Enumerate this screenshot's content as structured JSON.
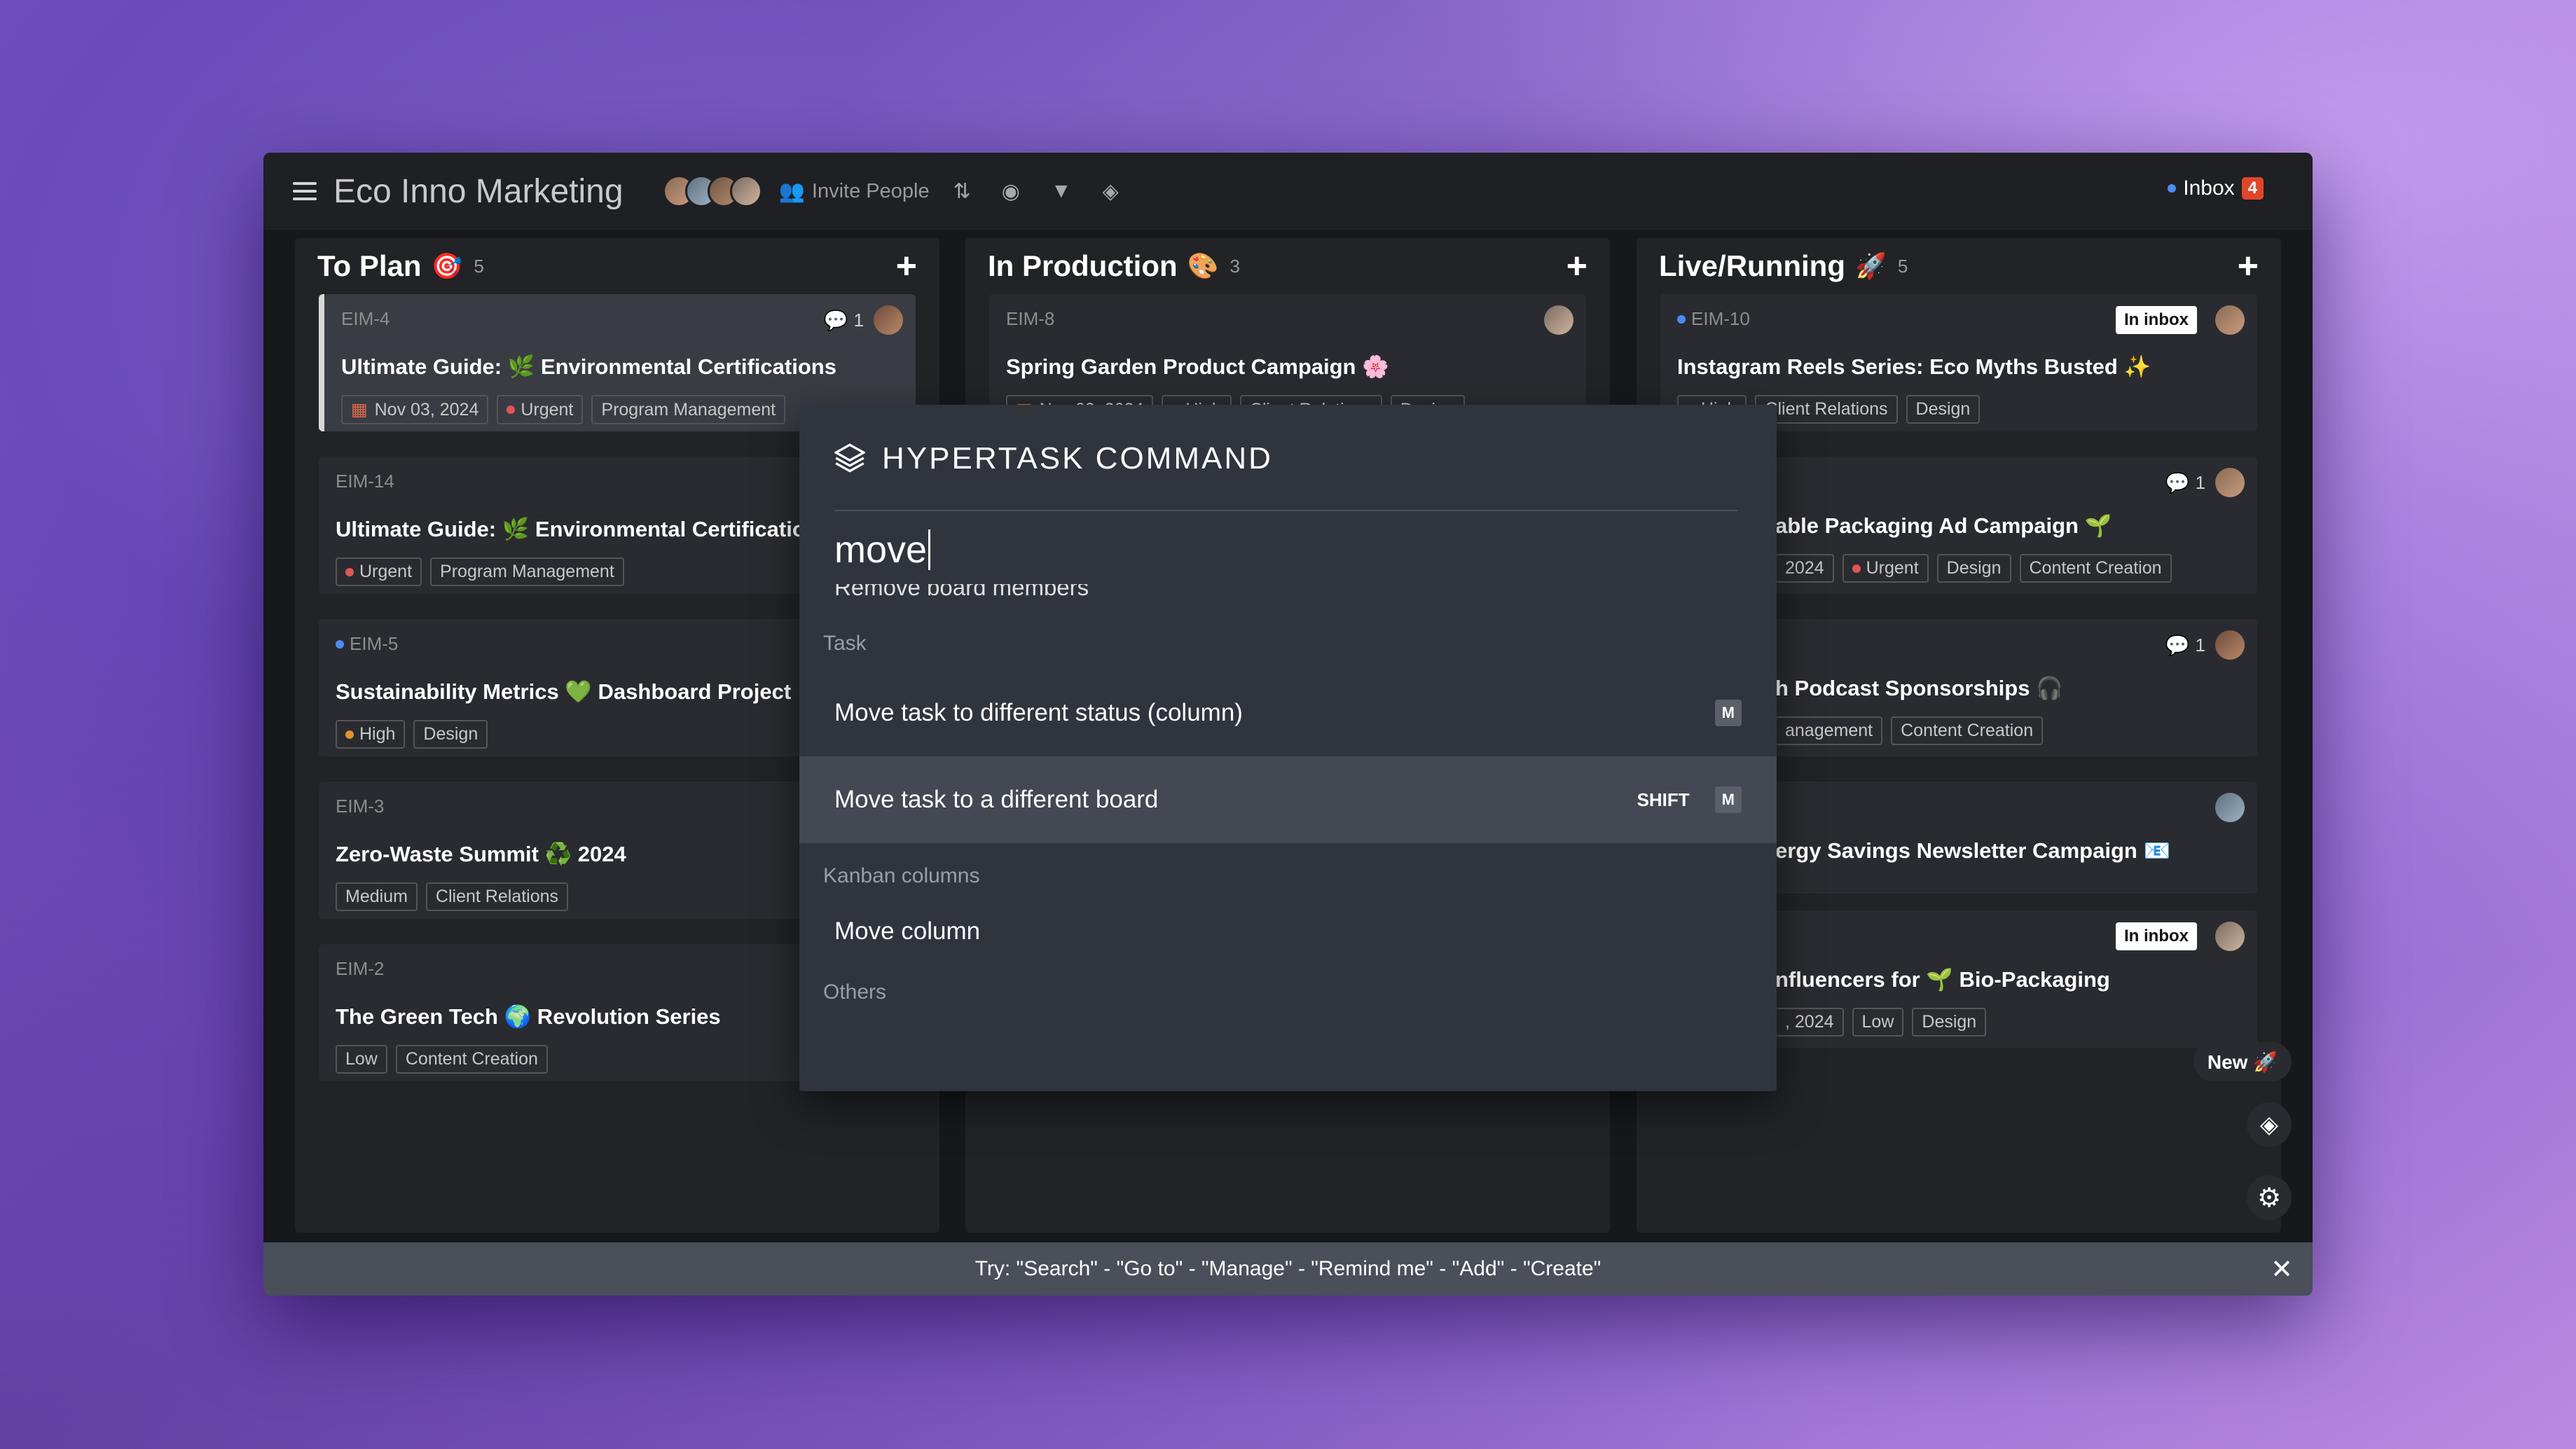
{
  "board": {
    "title": "Eco Inno Marketing",
    "invite_label": "Invite People",
    "inbox_label": "Inbox",
    "inbox_count": "4"
  },
  "columns": [
    {
      "title": "To Plan",
      "emoji": "🎯",
      "count": "5",
      "cards": [
        {
          "id": "EIM-4",
          "title": "Ultimate Guide: 🌿 Environmental Certifications",
          "date": "Nov 03, 2024",
          "priority": "Urgent",
          "tag": "Program Management",
          "comments": "1"
        },
        {
          "id": "EIM-14",
          "title": "Ultimate Guide: 🌿 Environmental Certifications",
          "priority": "Urgent",
          "tag": "Program Management"
        },
        {
          "id": "EIM-5",
          "title": "Sustainability Metrics 💚 Dashboard Project",
          "priority": "High",
          "tag": "Design"
        },
        {
          "id": "EIM-3",
          "title": "Zero-Waste Summit ♻️ 2024",
          "priority": "Medium",
          "tag": "Client Relations"
        },
        {
          "id": "EIM-2",
          "title": "The Green Tech 🌍 Revolution Series",
          "priority": "Low",
          "tag": "Content Creation"
        }
      ]
    },
    {
      "title": "In Production",
      "emoji": "🎨",
      "count": "3",
      "cards": [
        {
          "id": "EIM-8",
          "title": "Spring Garden Product Campaign 🌸",
          "date": "Nov 03, 2024",
          "priority": "High",
          "tag": "Client Relations",
          "tag2": "Design"
        }
      ]
    },
    {
      "title": "Live/Running",
      "emoji": "🚀",
      "count": "5",
      "cards": [
        {
          "id": "EIM-10",
          "title": "Instagram Reels Series: Eco Myths Busted ✨",
          "priority": "High",
          "tag": "Client Relations",
          "tag2": "Design",
          "inbox": "In inbox"
        },
        {
          "title": "able Packaging Ad Campaign 🌱",
          "date": "2024",
          "priority": "Urgent",
          "tag": "Design",
          "tag2": "Content Creation",
          "comments": "1"
        },
        {
          "title": "h Podcast Sponsorships 🎧",
          "tag": "anagement",
          "tag2": "Content Creation",
          "comments": "1"
        },
        {
          "title": "ergy Savings Newsletter Campaign 📧"
        },
        {
          "title": "nfluencers for 🌱 Bio-Packaging",
          "date": ", 2024",
          "priority": "Low",
          "tag": "Design",
          "inbox": "In inbox"
        }
      ]
    }
  ],
  "command": {
    "title": "HYPERTASK COMMAND",
    "query": "move",
    "clipped_item": "Remove board members",
    "sections": {
      "task": "Task",
      "kanban": "Kanban columns",
      "others": "Others"
    },
    "items": [
      {
        "label": "Move task to different status (column)",
        "key": "M"
      },
      {
        "label": "Move task to a different board",
        "modifier": "SHIFT",
        "key": "M"
      },
      {
        "label": "Move column"
      }
    ]
  },
  "floating": {
    "new_label": "New 🚀"
  },
  "hint": {
    "text": "Try: \"Search\"  -  \"Go to\"  -  \"Manage\"  -  \"Remind me\"  -  \"Add\"  -  \"Create\""
  },
  "colors": {
    "urgent": "#e05555",
    "high": "#e0922b",
    "low": "#6cb86c",
    "accent_blue": "#4a8cf0",
    "inbox_badge": "#e0452b"
  }
}
